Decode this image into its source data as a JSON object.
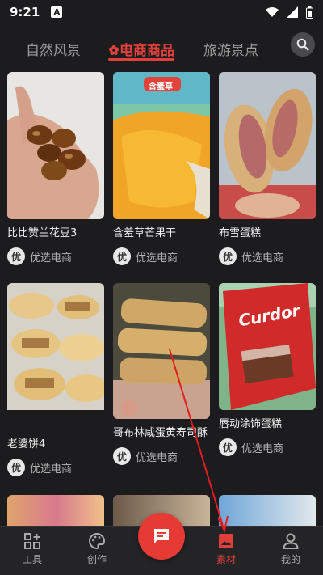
{
  "status_bar": {
    "time": "9:21",
    "notification_icon": "A"
  },
  "tabs": [
    {
      "label": "自然风景",
      "active": false
    },
    {
      "label": "电商商品",
      "active": true,
      "icon": "flower-icon"
    },
    {
      "label": "旅游景点",
      "active": false
    }
  ],
  "cards": [
    {
      "title": "比比赞兰花豆3",
      "source_badge": "优",
      "source": "优选电商"
    },
    {
      "title": "含羞草芒果干",
      "source_badge": "优",
      "source": "优选电商"
    },
    {
      "title": "布雪蛋糕",
      "source_badge": "优",
      "source": "优选电商"
    },
    {
      "title": "老婆饼4",
      "source_badge": "优",
      "source": "优选电商"
    },
    {
      "title": "哥布林咸蛋黄寿司酥",
      "source_badge": "优",
      "source": "优选电商"
    },
    {
      "title": "唇动涂饰蛋糕",
      "source_badge": "优",
      "source": "优选电商"
    }
  ],
  "thumb_texts": {
    "mango_pack": "含羞草",
    "cake_pack": "Curdor"
  },
  "nav": [
    {
      "label": "工具",
      "icon": "tools-grid-icon",
      "active": false
    },
    {
      "label": "创作",
      "icon": "palette-icon",
      "active": false
    },
    {
      "label": "素材",
      "icon": "image-icon",
      "active": true
    },
    {
      "label": "我的",
      "icon": "person-icon",
      "active": false
    }
  ],
  "colors": {
    "accent": "#e0403b",
    "background": "#1c1c1e"
  }
}
